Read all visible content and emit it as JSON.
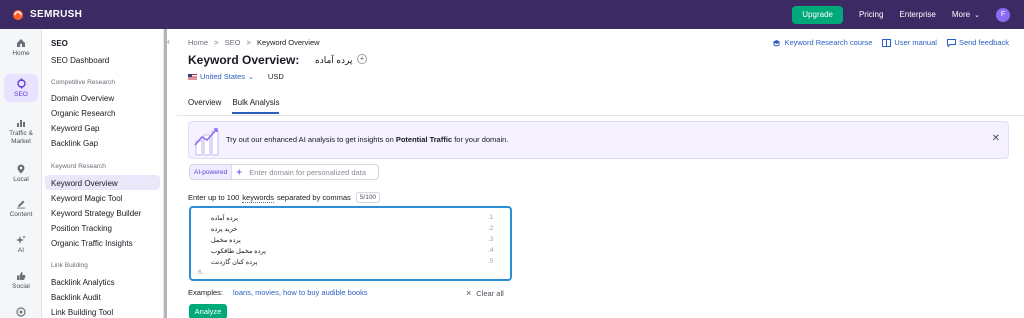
{
  "topbar": {
    "brand": "SEMRUSH",
    "upgrade": "Upgrade",
    "pricing": "Pricing",
    "enterprise": "Enterprise",
    "more": "More",
    "avatar_initial": "F"
  },
  "rail": {
    "home": "Home",
    "seo": "SEO",
    "traffic_line1": "Traffic &",
    "traffic_line2": "Market",
    "local": "Local",
    "content": "Content",
    "ai": "AI",
    "social": "Social"
  },
  "sidebar": {
    "title": "SEO",
    "dashboard": "SEO Dashboard",
    "competitive_research": "Competitive Research",
    "domain_overview": "Domain Overview",
    "organic_research": "Organic Research",
    "keyword_gap": "Keyword Gap",
    "backlink_gap": "Backlink Gap",
    "keyword_research": "Keyword Research",
    "keyword_overview": "Keyword Overview",
    "keyword_magic_tool": "Keyword Magic Tool",
    "keyword_strategy_builder": "Keyword Strategy Builder",
    "position_tracking": "Position Tracking",
    "organic_traffic_insights": "Organic Traffic Insights",
    "link_building": "Link Building",
    "backlink_analytics": "Backlink Analytics",
    "backlink_audit": "Backlink Audit",
    "link_building_tool": "Link Building Tool"
  },
  "breadcrumb": {
    "home": "Home",
    "seo": "SEO",
    "current": "Keyword Overview",
    "sep": ">"
  },
  "help": {
    "course": "Keyword Research course",
    "manual": "User manual",
    "feedback": "Send feedback"
  },
  "page": {
    "title": "Keyword Overview:",
    "keyword": "پرده آماده"
  },
  "database": {
    "country": "United States",
    "currency": "USD"
  },
  "tabs": {
    "overview": "Overview",
    "bulk": "Bulk Analysis"
  },
  "banner": {
    "text_before": "Try out our enhanced AI analysis to get insights on",
    "text_bold": "Potential Traffic",
    "text_after": "for your domain."
  },
  "ai": {
    "badge": "AI-powered",
    "placeholder": "Enter domain for personalized data"
  },
  "bulk": {
    "label_before": "Enter up to 100",
    "label_link": "keywords",
    "label_after": "separated by commas",
    "counter": "5/100",
    "keywords": [
      {
        "num": ".1",
        "text": "پرده آماده"
      },
      {
        "num": ".2",
        "text": "خرید پرده"
      },
      {
        "num": ".3",
        "text": "پرده مخمل"
      },
      {
        "num": ".4",
        "text": "پرده مخمل طاقکوب"
      },
      {
        "num": ".5",
        "text": "پرده کتان گاردنت"
      }
    ],
    "next_num": "6."
  },
  "examples": {
    "label": "Examples:",
    "items": "loans, movies, how to buy audible books",
    "clear": "Clear all"
  },
  "analyze": "Analyze"
}
